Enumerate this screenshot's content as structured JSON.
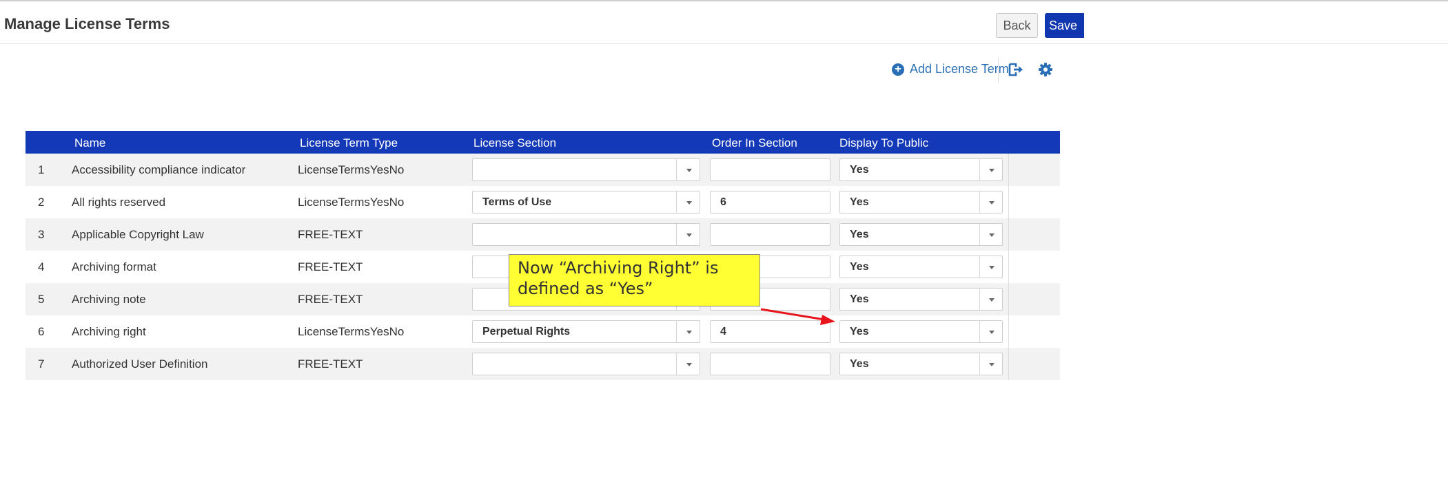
{
  "header": {
    "title": "Manage License Terms",
    "back_label": "Back",
    "save_label": "Save"
  },
  "toolbar": {
    "add_label": "Add License Term",
    "add_icon": "plus-circle-icon",
    "export_icon": "export-icon",
    "settings_icon": "gear-icon"
  },
  "table": {
    "columns": {
      "name": "Name",
      "type": "License Term Type",
      "section": "License Section",
      "order": "Order In Section",
      "public": "Display To Public"
    },
    "rows": [
      {
        "index": "1",
        "name": "Accessibility compliance indicator",
        "type": "LicenseTermsYesNo",
        "section": "",
        "order": "",
        "public": "Yes"
      },
      {
        "index": "2",
        "name": "All rights reserved",
        "type": "LicenseTermsYesNo",
        "section": "Terms of Use",
        "order": "6",
        "public": "Yes"
      },
      {
        "index": "3",
        "name": "Applicable Copyright Law",
        "type": "FREE-TEXT",
        "section": "",
        "order": "",
        "public": "Yes"
      },
      {
        "index": "4",
        "name": "Archiving format",
        "type": "FREE-TEXT",
        "section": "",
        "order": "",
        "public": "Yes"
      },
      {
        "index": "5",
        "name": "Archiving note",
        "type": "FREE-TEXT",
        "section": "",
        "order": "",
        "public": "Yes"
      },
      {
        "index": "6",
        "name": "Archiving right",
        "type": "LicenseTermsYesNo",
        "section": "Perpetual Rights",
        "order": "4",
        "public": "Yes"
      },
      {
        "index": "7",
        "name": "Authorized User Definition",
        "type": "FREE-TEXT",
        "section": "",
        "order": "",
        "public": "Yes"
      }
    ]
  },
  "callout": {
    "line1": "Now “Archiving Right” is",
    "line2": "defined as “Yes”"
  },
  "colors": {
    "header_bar": "#1338b8",
    "save_button": "#1036b0",
    "link": "#2a6fb6",
    "callout_bg": "#ffff33",
    "arrow": "#e8141b"
  }
}
